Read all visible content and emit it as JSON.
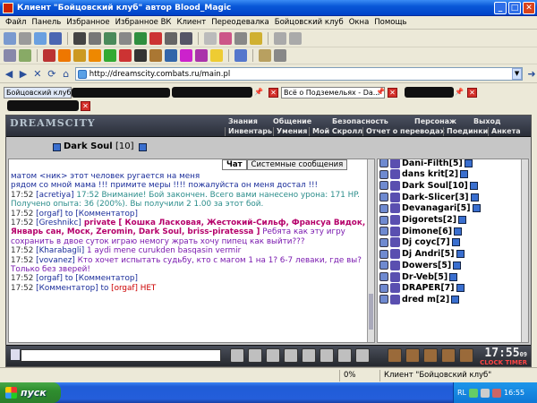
{
  "window": {
    "title": "Клиент \"Бойцовский клуб\" автор Blood_Magic"
  },
  "menubar": [
    "Файл",
    "Панель",
    "Избранное",
    "Избранное ВК",
    "Клиент",
    "Переодевалка",
    "Бойцовский клуб",
    "Окна",
    "Помощь"
  ],
  "address": {
    "url": "http://dreamscity.combats.ru/main.pl"
  },
  "tabs": [
    {
      "label": "Бойцовский клуб"
    },
    {
      "label": "Всё о Подземельях - Da..."
    }
  ],
  "game": {
    "logo": "DREAMSCITY",
    "menu_top": [
      "Знания",
      "Общение",
      "Безопасность",
      "Персонаж",
      "Выход"
    ],
    "menu_bottom": [
      "Инвентарь",
      "Умения",
      "Мой Скролл",
      "Отчет о переводах",
      "Поединки",
      "Анкета"
    ],
    "character": {
      "name": "Dark Soul",
      "level": "[10]"
    },
    "chat_tabs": [
      "Чат",
      "Системные сообщения"
    ],
    "chat_lines": [
      [
        {
          "t": "матом <ник> этот человек ругается на меня",
          "c": "nick"
        }
      ],
      [
        {
          "t": "рядом со мной мама !!! примите меры !!!! пожалуйста он меня достал !!!",
          "c": "nick"
        }
      ],
      [
        {
          "t": "17:52 ",
          "c": "ts"
        },
        {
          "t": "[acretiya]",
          "c": "nick"
        },
        {
          "t": " 17:52 Внимание! Бой закончен. Всего вами нанесено урона: 171 HP. Получено опыта: 36 (200%). Вы получили 2 1.00 за этот бой.",
          "c": "sys"
        }
      ],
      [
        {
          "t": "17:52 ",
          "c": "ts"
        },
        {
          "t": "[orgaf]",
          "c": "nick"
        },
        {
          "t": " to [Комментатор]",
          "c": "nick"
        }
      ],
      [
        {
          "t": "17:52 ",
          "c": "ts"
        },
        {
          "t": "[Greshnikc]",
          "c": "nick"
        },
        {
          "t": " private [ Кошка Ласковая, Жестокий-Сильф, Франсуа Видок, Январь сан, Моск, Zeromin, Dark Soul, briss-piratessa ]",
          "c": "priv"
        },
        {
          "t": " Ребята как эту игру сохранить в двое суток играю немогу жрать хочу пипец как выйти???",
          "c": "violet"
        }
      ],
      [
        {
          "t": "17:52 ",
          "c": "ts"
        },
        {
          "t": "[Kharabagli]",
          "c": "nick"
        },
        {
          "t": " 1 aydi mene curukden basqasin vermir",
          "c": "violet"
        }
      ],
      [
        {
          "t": "17:52 ",
          "c": "ts"
        },
        {
          "t": "[vovanez]",
          "c": "nick"
        },
        {
          "t": "     Кто хочет испытать судьбу, кто с магом 1 на 1? 6-7 леваки, где вы? Только без зверей!",
          "c": "violet"
        }
      ],
      [
        {
          "t": "17:52 ",
          "c": "ts"
        },
        {
          "t": "[orgaf]",
          "c": "nick"
        },
        {
          "t": " to [Комментатор]",
          "c": "nick"
        }
      ],
      [
        {
          "t": "17:52 ",
          "c": "ts"
        },
        {
          "t": "[Комментатор]",
          "c": "nick"
        },
        {
          "t": " to ",
          "c": "nick"
        },
        {
          "t": "[orgaf]",
          "c": "red"
        },
        {
          "t": " НЕТ",
          "c": "red"
        }
      ]
    ],
    "users": [
      {
        "name": "Dani-Filth",
        "level": "[5]"
      },
      {
        "name": "dans krit",
        "level": "[2]"
      },
      {
        "name": "Dark Soul",
        "level": "[10]"
      },
      {
        "name": "Dark-Slicer",
        "level": "[3]"
      },
      {
        "name": "Devanagari",
        "level": "[5]"
      },
      {
        "name": "Digorets",
        "level": "[2]"
      },
      {
        "name": "Dimone",
        "level": "[6]"
      },
      {
        "name": "Dj coyc",
        "level": "[7]"
      },
      {
        "name": "Dj Andri",
        "level": "[5]"
      },
      {
        "name": "Dowers",
        "level": "[5]"
      },
      {
        "name": "Dr-Veb",
        "level": "[5]"
      },
      {
        "name": "DRAPER",
        "level": "[7]"
      },
      {
        "name": "dred m",
        "level": "[2]"
      }
    ],
    "clock": "17:55",
    "clock_sec": "09",
    "timer_label": "CLOCK  TIMER"
  },
  "statusbar": {
    "zoom": "0%",
    "client": "Клиент \"Бойцовский клуб\""
  },
  "taskbar": {
    "start": "пуск",
    "lang": "RL",
    "time": "16:55"
  }
}
